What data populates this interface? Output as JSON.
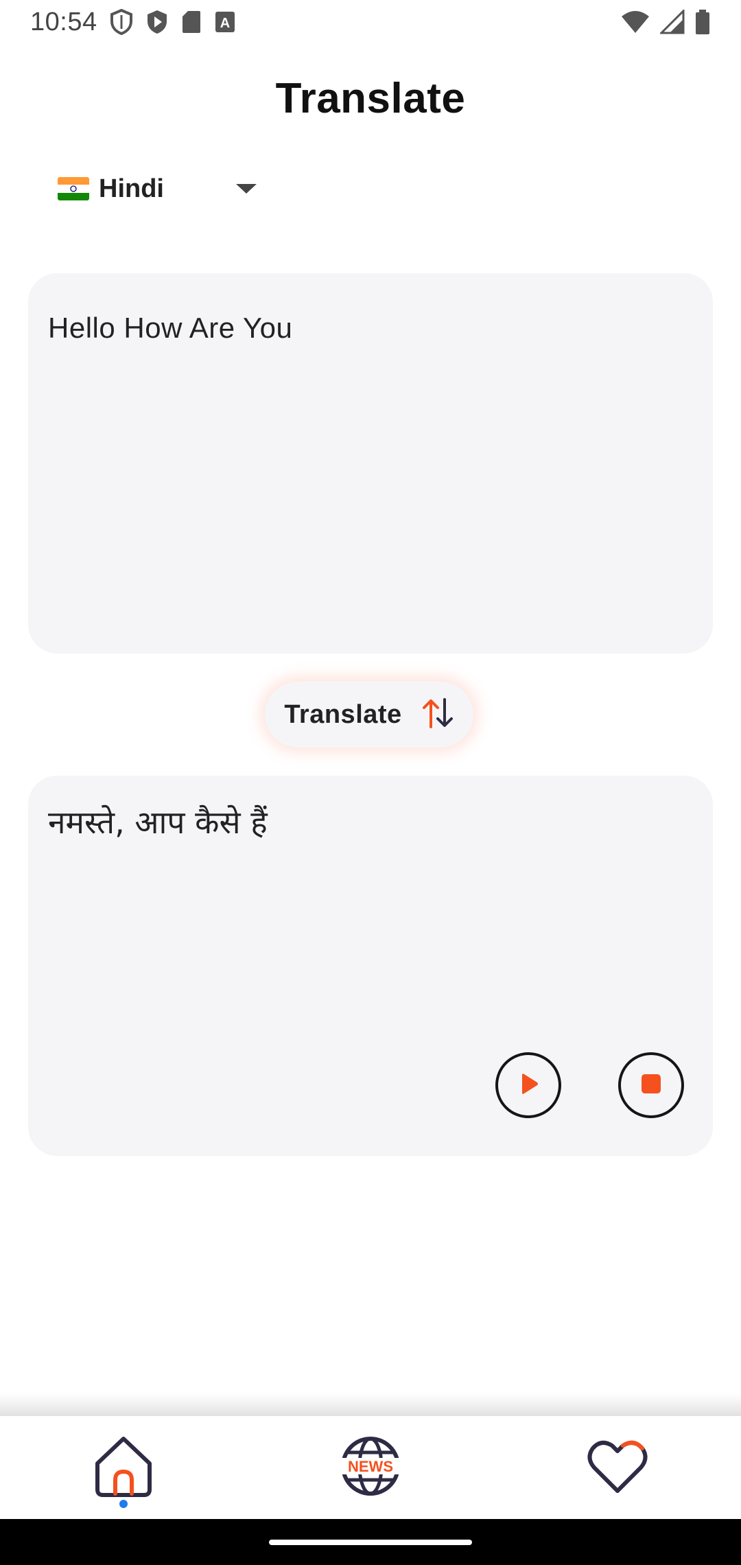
{
  "status_bar": {
    "time": "10:54"
  },
  "header": {
    "title": "Translate"
  },
  "language_selector": {
    "selected": "Hindi",
    "flag": "india-flag"
  },
  "input": {
    "text": "Hello How Are You"
  },
  "translate_button": {
    "label": "Translate",
    "icon": "swap-vertical-icon"
  },
  "output": {
    "text": "नमस्ते, आप कैसे हैं",
    "play_icon": "play-icon",
    "stop_icon": "stop-icon"
  },
  "bottom_nav": {
    "items": [
      {
        "icon": "home-icon",
        "active": true
      },
      {
        "icon": "news-globe-icon",
        "label": "NEWS"
      },
      {
        "icon": "heart-icon"
      }
    ]
  },
  "colors": {
    "accent": "#f4511e",
    "dark": "#2e2b45",
    "active_dot": "#1e7cf0",
    "box_bg": "#f5f5f7"
  }
}
